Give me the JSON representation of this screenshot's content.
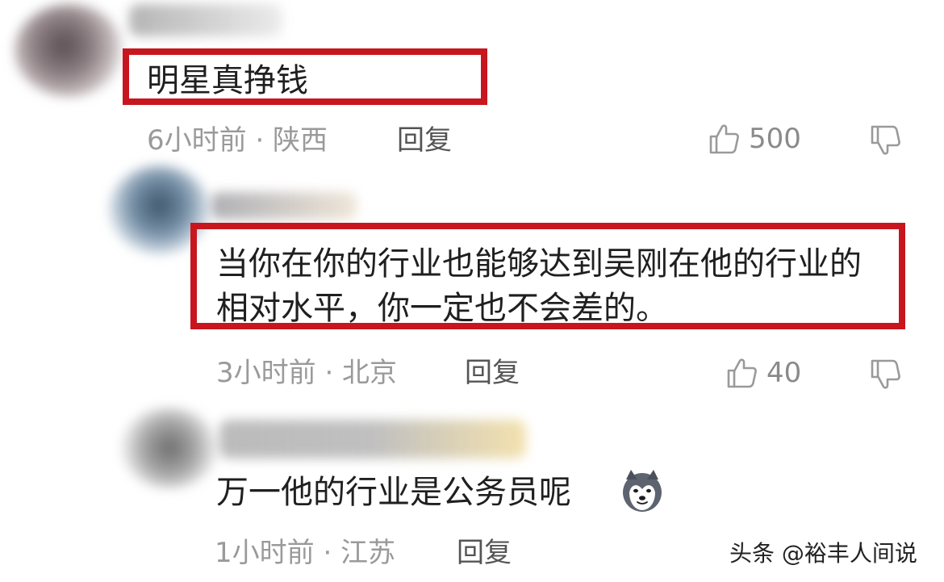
{
  "comments": [
    {
      "text": "明星真挣钱",
      "meta": "6小时前 · 陕西",
      "reply_label": "回复",
      "likes": "500"
    },
    {
      "text": "当你在你的行业也能够达到吴刚在他的行业的相对水平，你一定也不会差的。",
      "meta": "3小时前 · 北京",
      "reply_label": "回复",
      "likes": "40"
    },
    {
      "text": "万一他的行业是公务员呢",
      "meta": "1小时前 · 江苏",
      "reply_label": "回复"
    }
  ],
  "watermark": "头条 @裕丰人间说",
  "icons": {
    "like": "thumbs-up-icon",
    "dislike": "thumbs-down-icon",
    "emoji": "husky-dog-emoji"
  },
  "colors": {
    "highlight": "#c8161e",
    "meta_text": "#9a9a9a",
    "reply_text": "#555555"
  }
}
